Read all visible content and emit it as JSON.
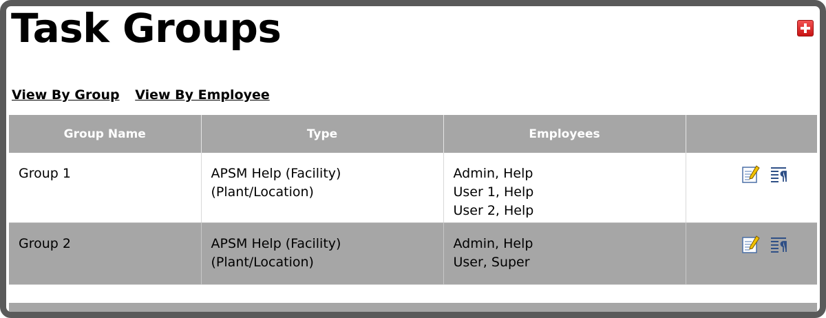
{
  "page": {
    "title": "Task Groups",
    "add_icon": "add-icon"
  },
  "views": {
    "by_group": "View By Group",
    "by_employee": "View By Employee"
  },
  "table": {
    "headers": [
      "Group Name",
      "Type",
      "Employees",
      ""
    ],
    "rows": [
      {
        "group_name": "Group 1",
        "type": "APSM Help (Facility) (Plant/Location)",
        "employees": [
          "Admin, Help",
          "User 1, Help",
          "User 2, Help"
        ],
        "actions": [
          "edit-icon",
          "details-icon"
        ]
      },
      {
        "group_name": "Group 2",
        "type": "APSM Help (Facility) (Plant/Location)",
        "employees": [
          "Admin, Help",
          "User, Super"
        ],
        "actions": [
          "edit-icon",
          "details-icon"
        ]
      }
    ]
  },
  "colors": {
    "header_bg": "#a6a6a6",
    "alt_row_bg": "#a6a6a6",
    "frame_border": "#5a5a5a",
    "add_button": "#e02a2a"
  }
}
